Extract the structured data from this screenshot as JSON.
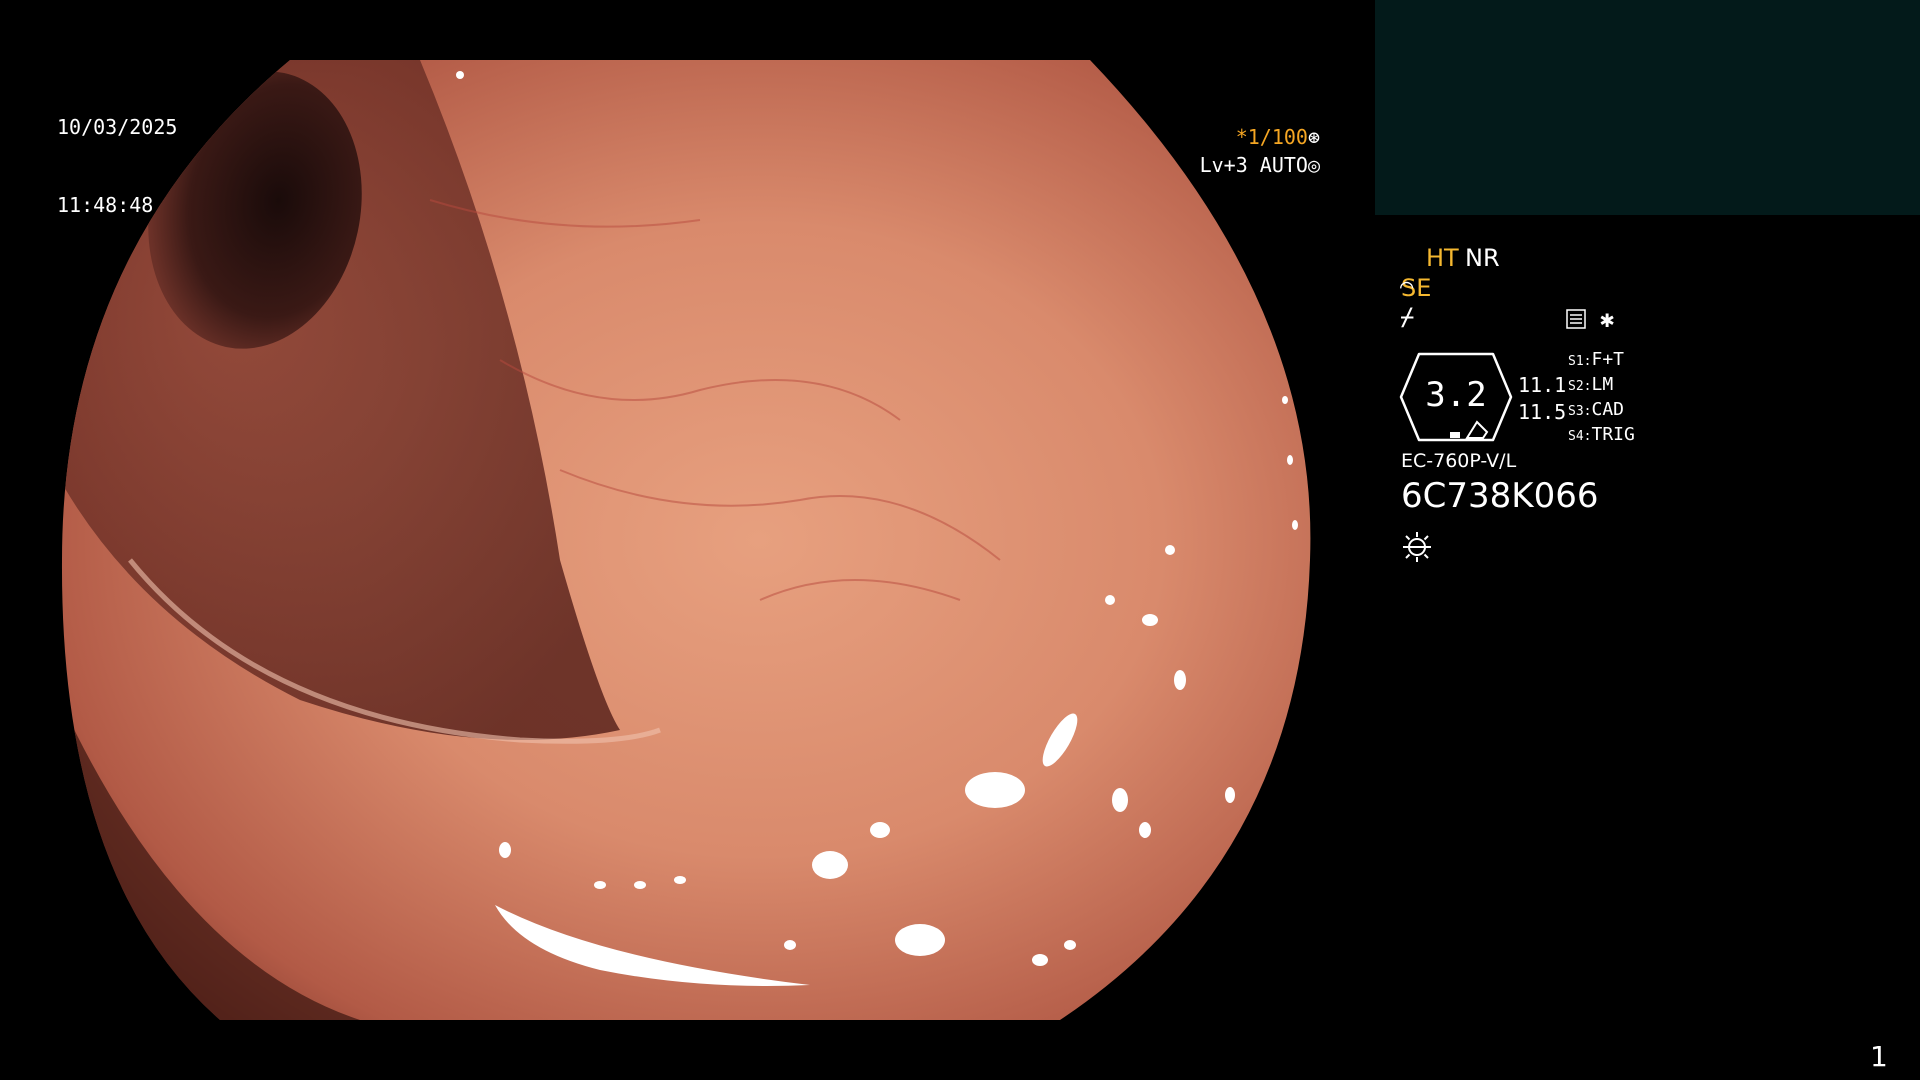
{
  "datetime": {
    "date": "10/03/2025",
    "time": "11:48:48"
  },
  "exposure": {
    "shutter": "*1/100",
    "level": "Lv+3 AUTO"
  },
  "modes": {
    "ht": "HT",
    "nr": "NR",
    "se": "SE"
  },
  "zoom": {
    "value": "3.2",
    "val_a": "11.1",
    "val_b": "11.5"
  },
  "switches": [
    {
      "prefix": "S1:",
      "label": "F+T"
    },
    {
      "prefix": "S2:",
      "label": "LM"
    },
    {
      "prefix": "S3:",
      "label": "CAD"
    },
    {
      "prefix": "S4:",
      "label": "TRIG"
    }
  ],
  "scope": {
    "model": "EC-760P-V/L",
    "serial": "6C738K066"
  },
  "page_number": "1",
  "icons": [
    "aperture-icon",
    "settings-dial-icon",
    "wave-icon",
    "menu-icon",
    "star-icon",
    "light-icon"
  ],
  "colors": {
    "accent_orange": "#f5a623",
    "thumb_bg": "#031a1a"
  }
}
